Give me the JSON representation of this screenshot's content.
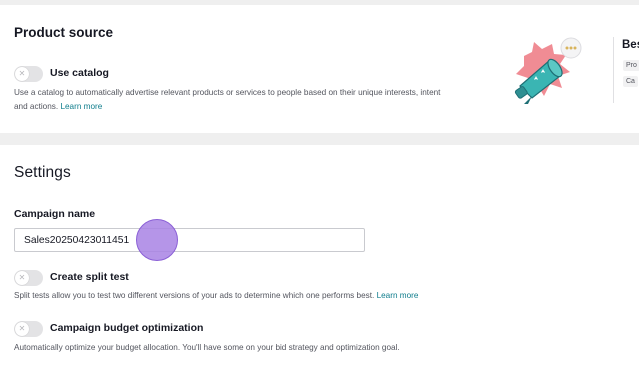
{
  "product_source": {
    "title": "Product source",
    "use_catalog_label": "Use catalog",
    "use_catalog_checked": false,
    "description_line1": "Use a catalog to automatically advertise relevant products or services to people based on their unique interests, intent",
    "description_line2": "and actions.",
    "learn_more": "Learn more",
    "side_title": "Bes",
    "side_tags": [
      "Pro",
      "Ca"
    ]
  },
  "settings": {
    "title": "Settings",
    "campaign_name_label": "Campaign name",
    "campaign_name_value": "Sales20250423011451",
    "split_test_label": "Create split test",
    "split_test_checked": false,
    "split_test_description": "Split tests allow you to test two different versions of your ads to determine which one performs best.",
    "split_test_learn_more": "Learn more",
    "budget_opt_label": "Campaign budget optimization",
    "budget_opt_checked": false,
    "budget_opt_description": "Automatically optimize your budget allocation. You'll have some on your bid strategy and optimization goal."
  },
  "colors": {
    "page_bg": "#efefef",
    "card_bg": "#ffffff",
    "link": "#0f7d8c",
    "cursor": "#a882e4",
    "illustration_pink": "#f08c94",
    "illustration_teal": "#3ab5b3"
  },
  "icons": {
    "toggle_knob": "x-icon",
    "illustration": "megaphone-illustration"
  }
}
